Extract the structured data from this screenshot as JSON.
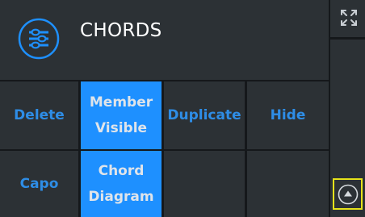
{
  "header": {
    "title": "CHORDS",
    "icon": "chord-settings-icon"
  },
  "grid": {
    "cells": [
      {
        "label": "Delete",
        "active": false
      },
      {
        "label": "Member\nVisible",
        "active": true
      },
      {
        "label": "Duplicate",
        "active": false
      },
      {
        "label": "Hide",
        "active": false
      },
      {
        "label": "Capo",
        "active": false
      },
      {
        "label": "Chord\nDiagram",
        "active": true
      },
      {
        "label": "",
        "active": false
      },
      {
        "label": "",
        "active": false
      }
    ]
  },
  "side": {
    "expand_icon": "expand-arrows-icon",
    "up_icon": "triangle-up-icon"
  },
  "colors": {
    "background": "#2c3135",
    "grid_line": "#15181b",
    "accent": "#1e90ff",
    "label_blue": "#2e8de6",
    "active_text": "#dfe4ea",
    "focus_outline": "#e6e21a"
  }
}
